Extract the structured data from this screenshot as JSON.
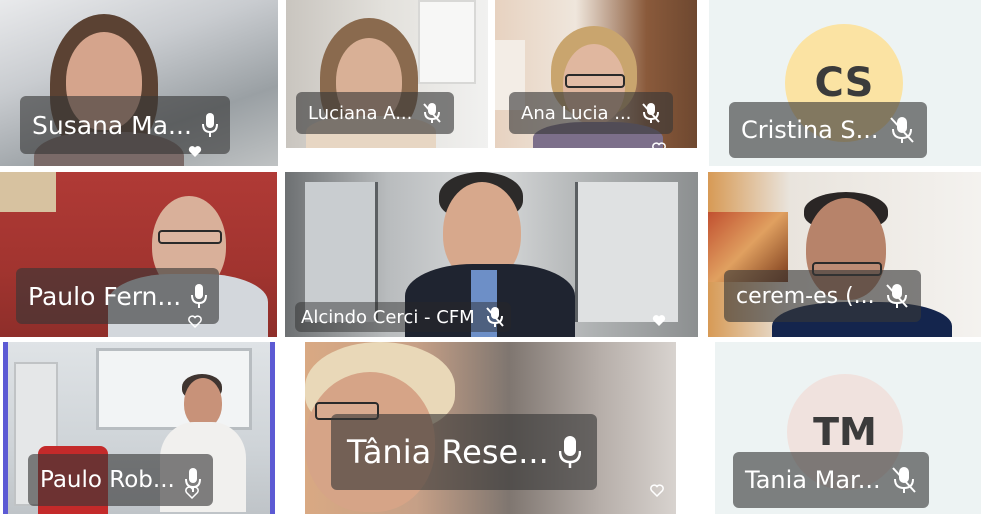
{
  "participants": [
    {
      "id": "t1",
      "name": "Susana Ma...",
      "mic": "on"
    },
    {
      "id": "t2",
      "name": "Luciana A...",
      "mic": "muted"
    },
    {
      "id": "t3",
      "name": "Ana Lucia ...",
      "mic": "muted"
    },
    {
      "id": "t4",
      "name": "Cristina S...",
      "mic": "muted",
      "initials": "CS",
      "avatar_color": "#fbe3a3"
    },
    {
      "id": "t5",
      "name": "Paulo Fern...",
      "mic": "on"
    },
    {
      "id": "t6",
      "name": "Alcindo Cerci - CFM",
      "mic": "muted"
    },
    {
      "id": "t7",
      "name": "cerem-es (...",
      "mic": "muted"
    },
    {
      "id": "t8",
      "name": "Paulo Rob...",
      "mic": "on"
    },
    {
      "id": "t9",
      "name": "Tânia Rese...",
      "mic": "on"
    },
    {
      "id": "t10",
      "name": "Tania Mar...",
      "mic": "muted",
      "initials": "TM",
      "avatar_color": "#f0e2de"
    }
  ],
  "colors": {
    "tile_bg_light": "#edf3f3",
    "nametag_bg": "rgba(55,55,55,0.62)",
    "nametag_text": "#ffffff"
  }
}
